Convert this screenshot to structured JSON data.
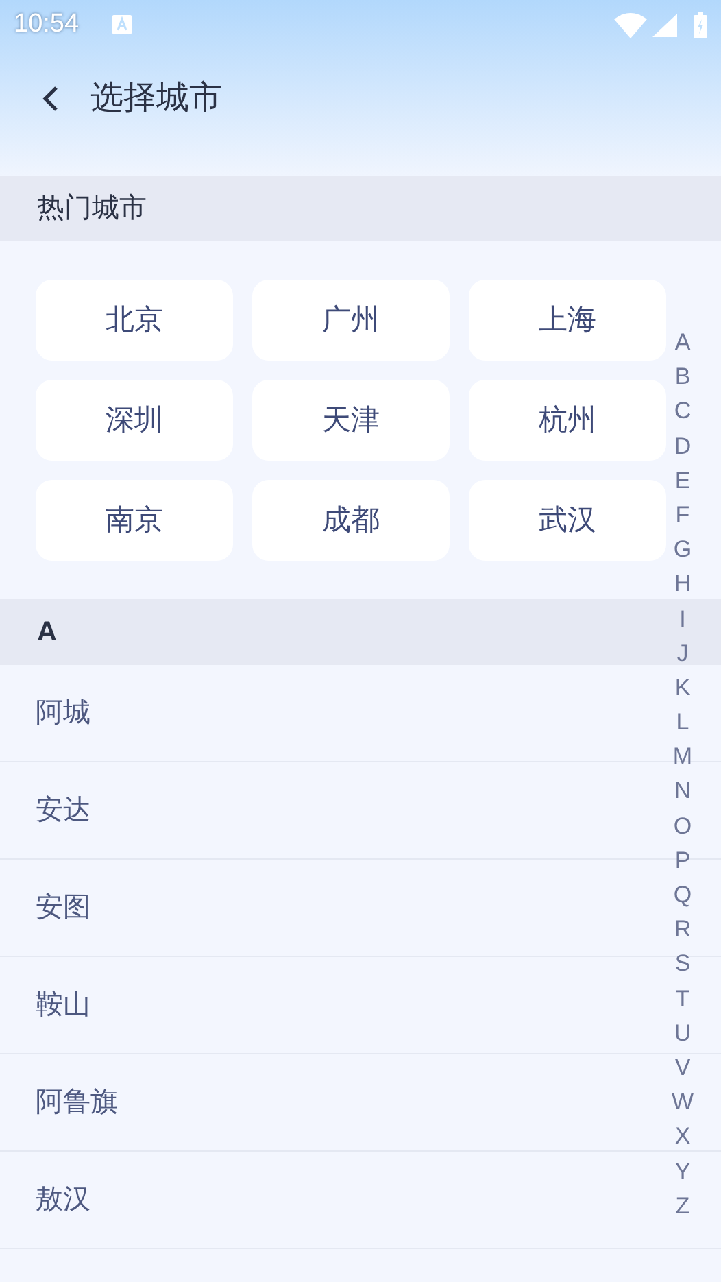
{
  "status_bar": {
    "time": "10:54"
  },
  "header": {
    "title": "选择城市"
  },
  "hot_section": {
    "title": "热门城市",
    "cities": [
      "北京",
      "广州",
      "上海",
      "深圳",
      "天津",
      "杭州",
      "南京",
      "成都",
      "武汉"
    ]
  },
  "groups": [
    {
      "letter": "A",
      "cities": [
        "阿城",
        "安达",
        "安图",
        "鞍山",
        "阿鲁旗",
        "敖汉"
      ]
    }
  ],
  "index_letters": [
    "A",
    "B",
    "C",
    "D",
    "E",
    "F",
    "G",
    "H",
    "I",
    "J",
    "K",
    "L",
    "M",
    "N",
    "O",
    "P",
    "Q",
    "R",
    "S",
    "T",
    "U",
    "V",
    "W",
    "X",
    "Y",
    "Z"
  ]
}
